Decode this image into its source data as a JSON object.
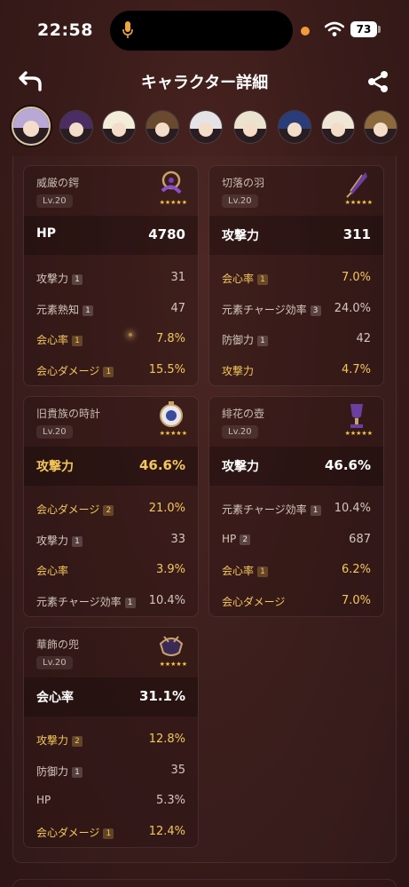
{
  "status_bar": {
    "time": "22:58",
    "battery": "73"
  },
  "header": {
    "title": "キャラクター詳細",
    "back_icon": "back-arrow-icon",
    "share_icon": "share-icon"
  },
  "avatars": [
    {
      "hair": "#b9a7d6",
      "selected": true
    },
    {
      "hair": "#4b2c63",
      "selected": false
    },
    {
      "hair": "#f3ecd8",
      "selected": false
    },
    {
      "hair": "#6a4a2e",
      "selected": false
    },
    {
      "hair": "#e6e3e6",
      "selected": false
    },
    {
      "hair": "#ece3cf",
      "selected": false
    },
    {
      "hair": "#2a3d7a",
      "selected": false
    },
    {
      "hair": "#efe6d6",
      "selected": false
    },
    {
      "hair": "#8c6a3b",
      "selected": false
    }
  ],
  "colors": {
    "gold": "#f3c75b",
    "background": "#3a1c1a"
  },
  "artifacts": [
    {
      "name": "威厳の鍔",
      "level": "Lv.20",
      "icon": "flower-artifact-icon",
      "stars": "★★★★★",
      "main": {
        "label": "HP",
        "value": "4780",
        "gold": false
      },
      "subs": [
        {
          "label": "攻撃力",
          "roll": "1",
          "value": "31",
          "gold": false
        },
        {
          "label": "元素熟知",
          "roll": "1",
          "value": "47",
          "gold": false
        },
        {
          "label": "会心率",
          "roll": "1",
          "value": "7.8%",
          "gold": true
        },
        {
          "label": "会心ダメージ",
          "roll": "1",
          "value": "15.5%",
          "gold": true
        }
      ]
    },
    {
      "name": "切落の羽",
      "level": "Lv.20",
      "icon": "feather-artifact-icon",
      "stars": "★★★★★",
      "main": {
        "label": "攻撃力",
        "value": "311",
        "gold": false
      },
      "subs": [
        {
          "label": "会心率",
          "roll": "1",
          "value": "7.0%",
          "gold": true
        },
        {
          "label": "元素チャージ効率",
          "roll": "3",
          "value": "24.0%",
          "gold": false
        },
        {
          "label": "防御力",
          "roll": "1",
          "value": "42",
          "gold": false
        },
        {
          "label": "攻撃力",
          "roll": "",
          "value": "4.7%",
          "gold": true
        }
      ]
    },
    {
      "name": "旧貴族の時計",
      "level": "Lv.20",
      "icon": "sands-artifact-icon",
      "stars": "★★★★★",
      "main": {
        "label": "攻撃力",
        "value": "46.6%",
        "gold": true
      },
      "subs": [
        {
          "label": "会心ダメージ",
          "roll": "2",
          "value": "21.0%",
          "gold": true
        },
        {
          "label": "攻撃力",
          "roll": "1",
          "value": "33",
          "gold": false
        },
        {
          "label": "会心率",
          "roll": "",
          "value": "3.9%",
          "gold": true
        },
        {
          "label": "元素チャージ効率",
          "roll": "1",
          "value": "10.4%",
          "gold": false
        }
      ]
    },
    {
      "name": "緋花の壺",
      "level": "Lv.20",
      "icon": "goblet-artifact-icon",
      "stars": "★★★★★",
      "main": {
        "label": "攻撃力",
        "value": "46.6%",
        "gold": false
      },
      "subs": [
        {
          "label": "元素チャージ効率",
          "roll": "1",
          "value": "10.4%",
          "gold": false
        },
        {
          "label": "HP",
          "roll": "2",
          "value": "687",
          "gold": false
        },
        {
          "label": "会心率",
          "roll": "1",
          "value": "6.2%",
          "gold": true
        },
        {
          "label": "会心ダメージ",
          "roll": "",
          "value": "7.0%",
          "gold": true
        }
      ]
    },
    {
      "name": "華飾の兜",
      "level": "Lv.20",
      "icon": "circlet-artifact-icon",
      "stars": "★★★★★",
      "main": {
        "label": "会心率",
        "value": "31.1%",
        "gold": false
      },
      "subs": [
        {
          "label": "攻撃力",
          "roll": "2",
          "value": "12.8%",
          "gold": true
        },
        {
          "label": "防御力",
          "roll": "1",
          "value": "35",
          "gold": false
        },
        {
          "label": "HP",
          "roll": "",
          "value": "5.3%",
          "gold": false
        },
        {
          "label": "会心ダメージ",
          "roll": "1",
          "value": "12.4%",
          "gold": true
        }
      ]
    }
  ]
}
